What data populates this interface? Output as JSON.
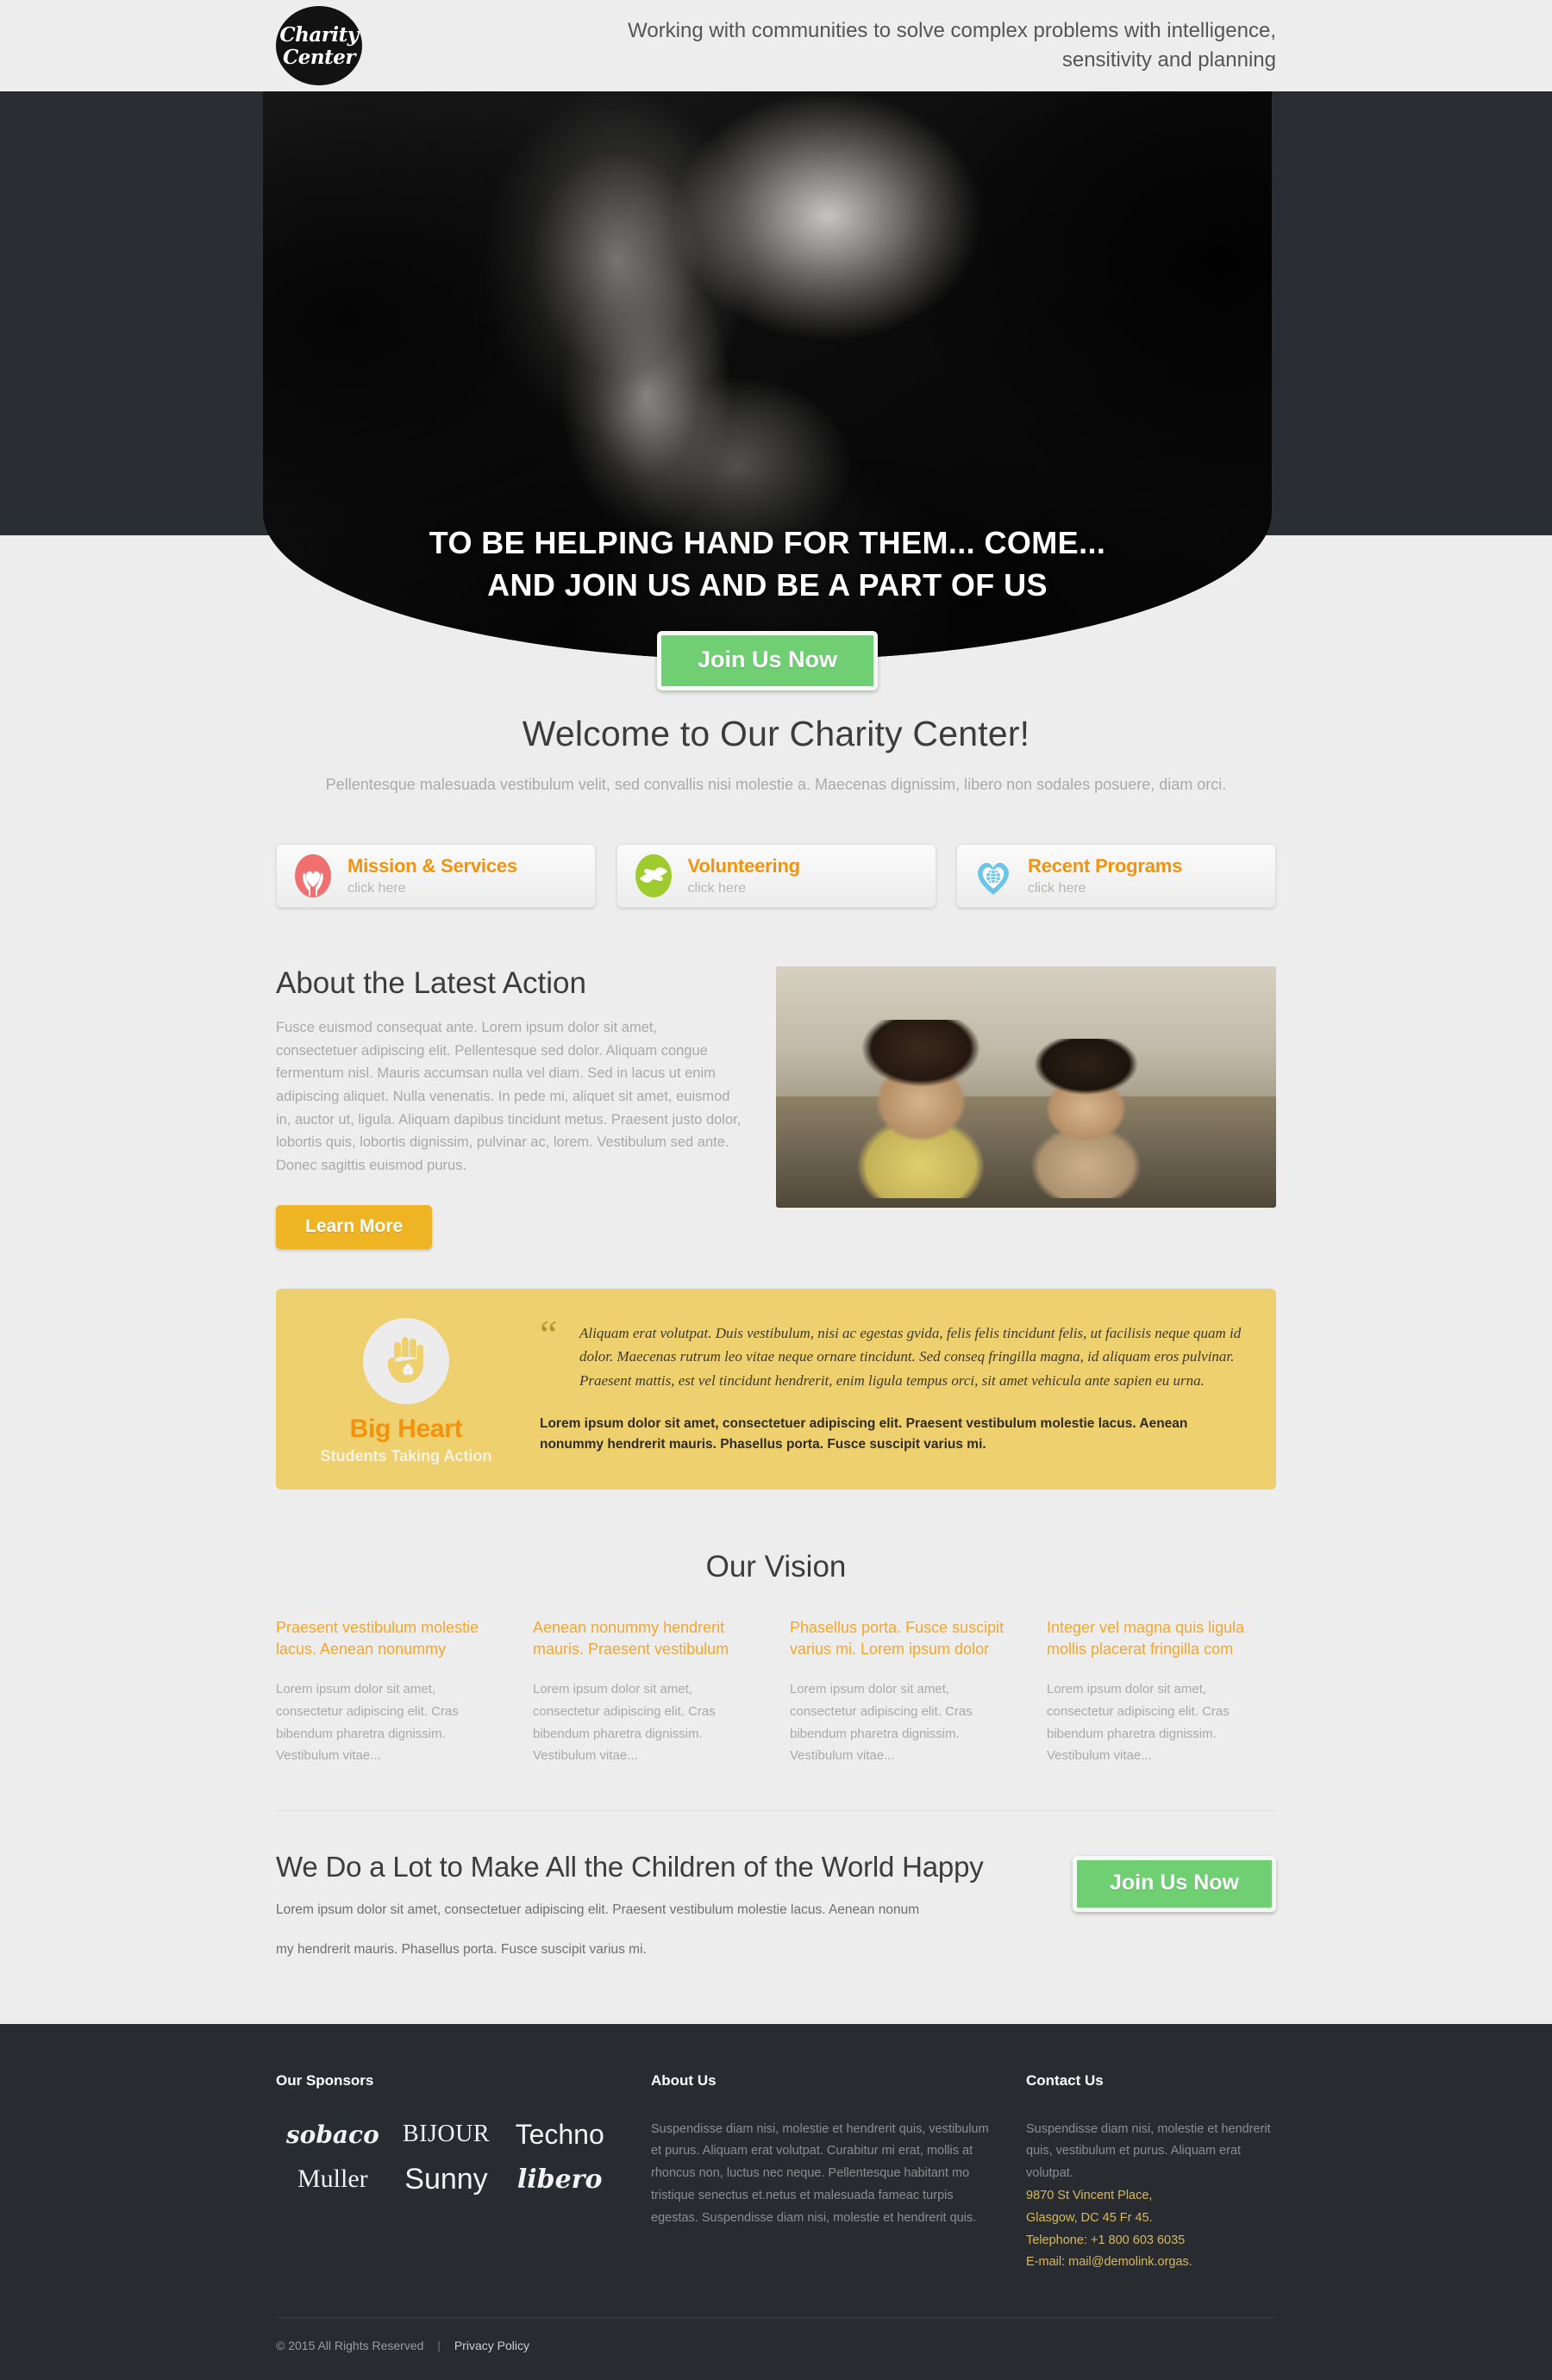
{
  "header": {
    "logo_line1": "Charity",
    "logo_line2": "Center",
    "tagline": "Working with communities to solve complex problems with intelligence, sensitivity and planning"
  },
  "hero": {
    "title_line1": "TO BE HELPING HAND FOR THEM... COME...",
    "title_line2": "AND JOIN US AND BE A PART OF US",
    "cta_label": "Join Us Now"
  },
  "welcome": {
    "heading": "Welcome to Our Charity Center!",
    "subtext": "Pellentesque malesuada vestibulum velit, sed convallis nisi molestie a. Maecenas dignissim, libero non sodales posuere, diam orci."
  },
  "features": [
    {
      "title": "Mission & Services",
      "sub": "click here",
      "icon": "hands-heart-icon",
      "color": "#f07070"
    },
    {
      "title": "Volunteering",
      "sub": "click here",
      "icon": "helping-hands-icon",
      "color": "#9ecb2e"
    },
    {
      "title": "Recent Programs",
      "sub": "click here",
      "icon": "heart-globe-icon",
      "color": "#6cc5e8"
    }
  ],
  "about": {
    "heading": "About the Latest Action",
    "body": "Fusce euismod consequat ante. Lorem ipsum dolor sit amet, consectetuer adipiscing elit. Pellentesque sed dolor. Aliquam congue fermentum nisl. Mauris accumsan nulla vel diam. Sed in lacus ut enim adipiscing aliquet. Nulla venenatis. In pede mi, aliquet sit amet, euismod in, auctor ut, ligula. Aliquam dapibus tincidunt metus. Praesent justo dolor, lobortis quis, lobortis dignissim, pulvinar ac, lorem. Vestibulum sed ante. Donec sagittis euismod purus.",
    "button_label": "Learn More",
    "image_alt": "two-children-sitting-photo"
  },
  "big_heart": {
    "title": "Big Heart",
    "subtitle": "Students Taking Action",
    "icon": "hand-heart-icon",
    "quote": "Aliquam erat volutpat. Duis vestibulum, nisi ac egestas gvida, felis felis tincidunt felis, ut facilisis neque quam id dolor. Maecenas rutrum leo vitae neque ornare tincidunt. Sed conseq fringilla magna, id aliquam eros pulvinar. Praesent mattis, est vel tincidunt hendrerit, enim ligula tempus orci, sit amet vehicula ante sapien eu urna.",
    "bold_text": "Lorem ipsum dolor sit amet, consectetuer adipiscing elit. Praesent vestibulum molestie lacus. Aenean nonummy hendrerit mauris. Phasellus porta. Fusce suscipit varius mi.",
    "bg_color": "#efd06e"
  },
  "vision": {
    "heading": "Our Vision",
    "columns": [
      {
        "title": "Praesent vestibulum molestie lacus. Aenean nonummy",
        "body": "Lorem ipsum dolor sit amet, consectetur adipiscing elit. Cras bibendum pharetra dignissim. Vestibulum vitae..."
      },
      {
        "title": "Aenean nonummy hendrerit mauris. Praesent vestibulum",
        "body": "Lorem ipsum dolor sit amet, consectetur adipiscing elit. Cras bibendum pharetra dignissim. Vestibulum vitae..."
      },
      {
        "title": "Phasellus porta. Fusce suscipit varius mi. Lorem ipsum dolor",
        "body": "Lorem ipsum dolor sit amet, consectetur adipiscing elit. Cras bibendum pharetra dignissim. Vestibulum vitae..."
      },
      {
        "title": "Integer vel magna quis ligula mollis placerat fringilla  com",
        "body": "Lorem ipsum dolor sit amet, consectetur adipiscing elit. Cras bibendum pharetra dignissim. Vestibulum vitae..."
      }
    ]
  },
  "cta": {
    "heading": "We Do a Lot to Make All the Children of the World Happy",
    "body_line1": "Lorem ipsum dolor sit amet, consectetuer adipiscing elit. Praesent vestibulum molestie lacus. Aenean nonum",
    "body_line2": "my hendrerit mauris. Phasellus porta. Fusce suscipit varius mi.",
    "button_label": "Join Us Now"
  },
  "footer": {
    "sponsors_heading": "Our Sponsors",
    "sponsors": [
      "sobaco",
      "BIJOUR",
      "Techno",
      "Muller",
      "Sunny",
      "libero"
    ],
    "about_heading": "About Us",
    "about_body": "Suspendisse diam nisi, molestie et hendrerit quis, vestibulum et purus. Aliquam erat volutpat. Curabitur mi erat, mollis at rhoncus non, luctus nec neque. Pellentesque habitant mo tristique senectus et.netus et malesuada fameac turpis egestas. Suspendisse diam nisi, molestie et hendrerit quis.",
    "contact_heading": "Contact Us",
    "contact_body": "Suspendisse diam nisi, molestie et hendrerit quis, vestibulum et purus. Aliquam erat volutpat.",
    "contact_address1": "9870 St Vincent Place,",
    "contact_address2": "Glasgow, DC 45 Fr 45.",
    "contact_phone": "Telephone:  +1 800 603 6035",
    "contact_email": "E-mail: mail@demolink.orgas.",
    "copyright": "© 2015 All Rights Reserved",
    "separator": "|",
    "privacy_label": "Privacy Policy",
    "accent_color": "#d8b75e"
  }
}
